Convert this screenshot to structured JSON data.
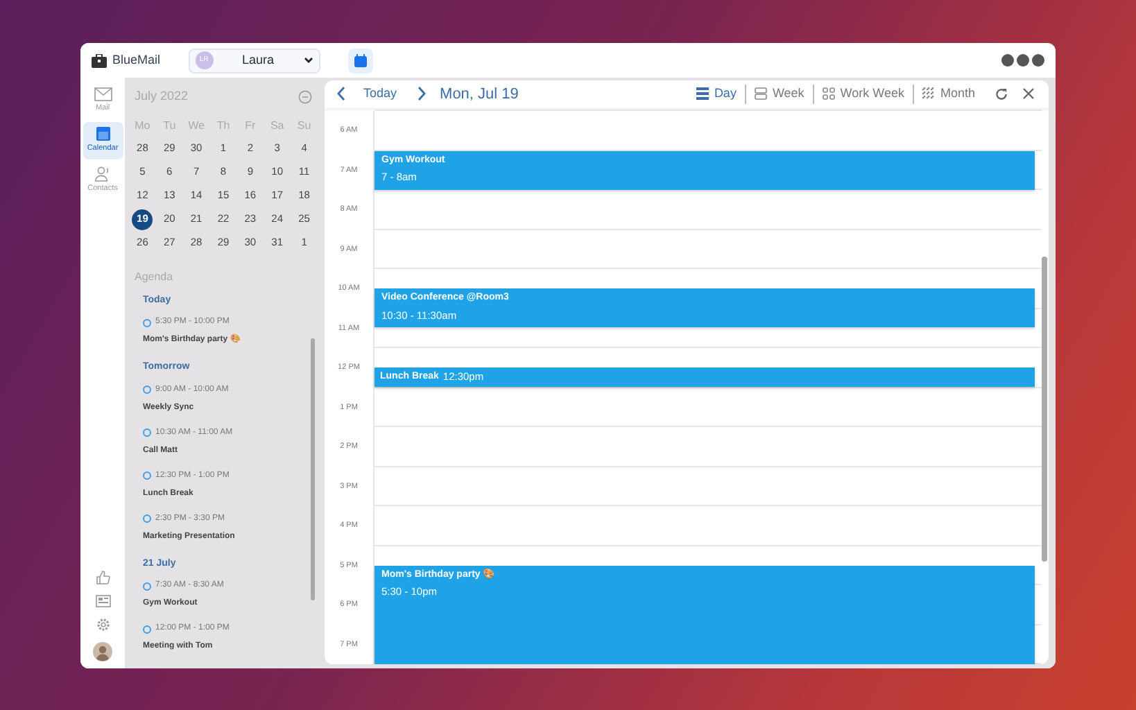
{
  "app": {
    "name": "BlueMail"
  },
  "account": {
    "initials": "LR",
    "name": "Laura"
  },
  "nav": [
    {
      "label": "Mail",
      "kind": "mail",
      "selected": false
    },
    {
      "label": "Calendar",
      "kind": "calendar",
      "selected": true
    },
    {
      "label": "Contacts",
      "kind": "contacts",
      "selected": false
    }
  ],
  "mini_calendar": {
    "month": "July 2022",
    "weekdays": [
      "Mo",
      "Tu",
      "We",
      "Th",
      "Fr",
      "Sa",
      "Su"
    ],
    "days": [
      {
        "label": "28",
        "selected": false
      },
      {
        "label": "29",
        "selected": false
      },
      {
        "label": "30",
        "selected": false
      },
      {
        "label": "1",
        "selected": false
      },
      {
        "label": "2",
        "selected": false
      },
      {
        "label": "3",
        "selected": false
      },
      {
        "label": "4",
        "selected": false
      },
      {
        "label": "5",
        "selected": false
      },
      {
        "label": "6",
        "selected": false
      },
      {
        "label": "7",
        "selected": false
      },
      {
        "label": "8",
        "selected": false
      },
      {
        "label": "9",
        "selected": false
      },
      {
        "label": "10",
        "selected": false
      },
      {
        "label": "11",
        "selected": false
      },
      {
        "label": "12",
        "selected": false
      },
      {
        "label": "13",
        "selected": false
      },
      {
        "label": "14",
        "selected": false
      },
      {
        "label": "15",
        "selected": false
      },
      {
        "label": "16",
        "selected": false
      },
      {
        "label": "17",
        "selected": false
      },
      {
        "label": "18",
        "selected": false
      },
      {
        "label": "19",
        "selected": true
      },
      {
        "label": "20",
        "selected": false
      },
      {
        "label": "21",
        "selected": false
      },
      {
        "label": "22",
        "selected": false
      },
      {
        "label": "23",
        "selected": false
      },
      {
        "label": "24",
        "selected": false
      },
      {
        "label": "25",
        "selected": false
      },
      {
        "label": "26",
        "selected": false
      },
      {
        "label": "27",
        "selected": false
      },
      {
        "label": "28",
        "selected": false
      },
      {
        "label": "29",
        "selected": false
      },
      {
        "label": "30",
        "selected": false
      },
      {
        "label": "31",
        "selected": false
      },
      {
        "label": "1",
        "selected": false
      }
    ]
  },
  "agenda": {
    "title": "Agenda",
    "groups": [
      {
        "heading": "Today",
        "items": [
          {
            "time": "5:30 PM - 10:00 PM",
            "title": "Mom's Birthday party 🎨"
          }
        ]
      },
      {
        "heading": "Tomorrow",
        "items": [
          {
            "time": "9:00 AM - 10:00 AM",
            "title": "Weekly Sync"
          },
          {
            "time": "10:30 AM - 11:00 AM",
            "title": "Call Matt"
          },
          {
            "time": "12:30 PM - 1:00 PM",
            "title": "Lunch Break"
          },
          {
            "time": "2:30 PM - 3:30 PM",
            "title": "Marketing Presentation"
          }
        ]
      },
      {
        "heading": "21 July",
        "items": [
          {
            "time": "7:30 AM - 8:30 AM",
            "title": "Gym Workout"
          },
          {
            "time": "12:00 PM - 1:00 PM",
            "title": "Meeting with Tom"
          }
        ]
      }
    ]
  },
  "toolbar": {
    "today": "Today",
    "date": "Mon, Jul 19",
    "views": [
      {
        "label": "Day",
        "kind": "day",
        "selected": true
      },
      {
        "label": "Week",
        "kind": "week",
        "selected": false
      },
      {
        "label": "Work Week",
        "kind": "workweek",
        "selected": false
      },
      {
        "label": "Month",
        "kind": "month",
        "selected": false
      }
    ]
  },
  "day_view": {
    "hours": [
      {
        "label": "6 AM"
      },
      {
        "label": "7 AM",
        "events": [
          {
            "title": "Gym Workout",
            "time": "7 - 8am",
            "kind": "block"
          }
        ]
      },
      {
        "label": "8 AM"
      },
      {
        "label": "9 AM"
      },
      {
        "label": "10 AM",
        "events": [
          {
            "title": "Video Conference @Room3",
            "time": "10:30 - 11:30am",
            "kind": "shifted"
          }
        ]
      },
      {
        "label": "11 AM"
      },
      {
        "label": "12 PM",
        "events": [
          {
            "title": "Lunch Break",
            "time": "12:30pm",
            "kind": "strip"
          }
        ]
      },
      {
        "label": "1 PM"
      },
      {
        "label": "2 PM"
      },
      {
        "label": "3 PM"
      },
      {
        "label": "4 PM"
      },
      {
        "label": "5 PM",
        "events": [
          {
            "title": "Mom's Birthday party 🎨",
            "time": "5:30 - 10pm",
            "kind": "tall"
          }
        ]
      },
      {
        "label": "6 PM"
      },
      {
        "label": "7 PM"
      }
    ]
  }
}
